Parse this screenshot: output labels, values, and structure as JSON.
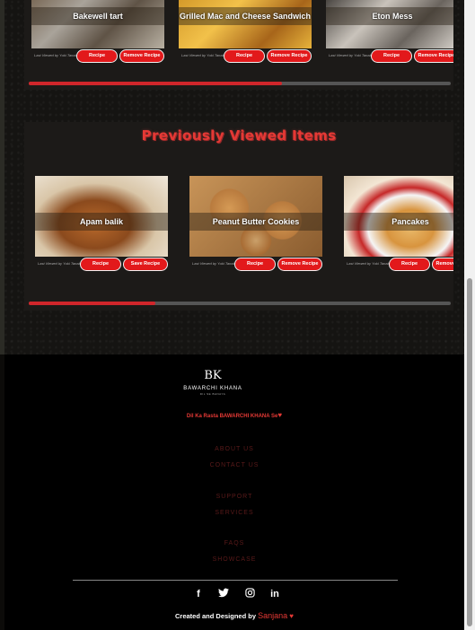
{
  "recipes_carousel": {
    "cards": [
      {
        "title": "Bakewell tart",
        "last_viewed": "Last Viewed by Yuki Tanaka",
        "recipe_label": "Recipe",
        "action_label": "Remove Recipe"
      },
      {
        "title": "Grilled Mac and Cheese Sandwich",
        "last_viewed": "Last Viewed by Yuki Tanaka",
        "recipe_label": "Recipe",
        "action_label": "Remove Recipe"
      },
      {
        "title": "Eton Mess",
        "last_viewed": "Last Viewed by Yuki Tanaka",
        "recipe_label": "Recipe",
        "action_label": "Remove Recipe"
      }
    ],
    "scroll_position": 0.6
  },
  "previously_viewed": {
    "title": "Previously Viewed Items",
    "cards": [
      {
        "title": "Apam balik",
        "last_viewed": "Last Viewed by Yuki Tanaka",
        "recipe_label": "Recipe",
        "action_label": "Save Recipe"
      },
      {
        "title": "Peanut Butter Cookies",
        "last_viewed": "Last Viewed by Yuki Tanaka",
        "recipe_label": "Recipe",
        "action_label": "Remove Recipe"
      },
      {
        "title": "Pancakes",
        "last_viewed": "Last Viewed by Yuki Tanaka",
        "recipe_label": "Recipe",
        "action_label": "Remove Recipe"
      }
    ],
    "scroll_position": 0.3
  },
  "footer": {
    "logo_mark": "BK",
    "logo_name": "BAWARCHI KHANA",
    "logo_sub": "DIL SE BANAYA",
    "tagline": "Dil Ka Rasta BAWARCHI KHANA Se",
    "links": [
      "ABOUT US",
      "CONTACT US",
      "SUPPORT",
      "SERVICES",
      "FAQS",
      "SHOWCASE"
    ],
    "social_icons": [
      "facebook-icon",
      "twitter-icon",
      "instagram-icon",
      "linkedin-icon"
    ],
    "credit_prefix": "Created and Designed by",
    "credit_author": "Sanjana"
  },
  "colors": {
    "accent": "#e2191b",
    "title_red": "#e53935",
    "footer_bg": "#000000"
  }
}
